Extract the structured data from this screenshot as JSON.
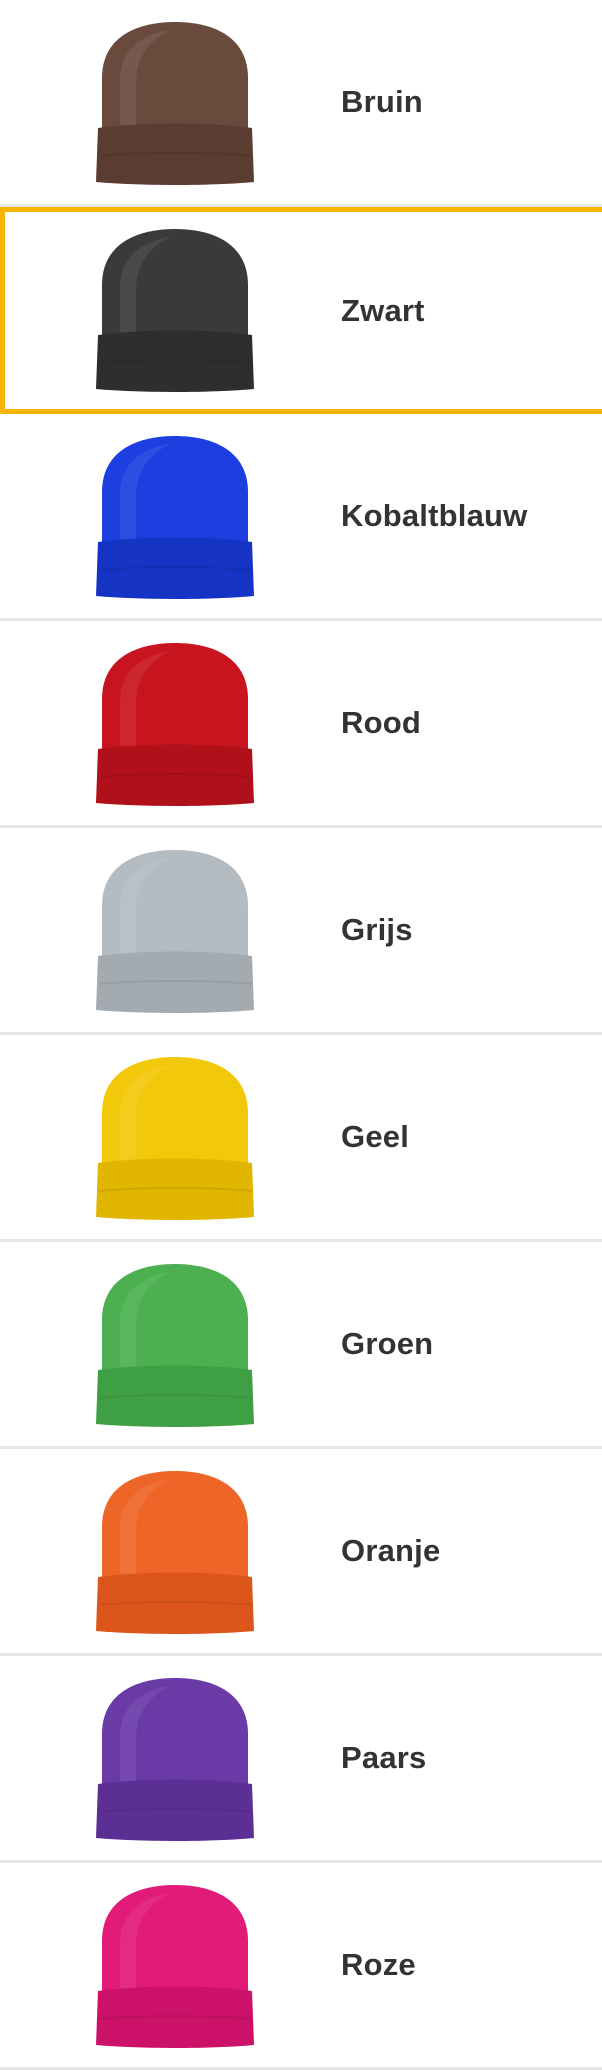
{
  "selected_index": 1,
  "colors": [
    {
      "label": "Bruin",
      "hex": "#6b4a3e",
      "shade": "#5a3c31",
      "icon": "beanie-brown-icon"
    },
    {
      "label": "Zwart",
      "hex": "#3a3a3d",
      "shade": "#2e2e31",
      "icon": "beanie-black-icon"
    },
    {
      "label": "Kobaltblauw",
      "hex": "#1d3fe0",
      "shade": "#1634c4",
      "icon": "beanie-cobalt-blue-icon"
    },
    {
      "label": "Rood",
      "hex": "#c8141f",
      "shade": "#b01019",
      "icon": "beanie-red-icon"
    },
    {
      "label": "Grijs",
      "hex": "#b4bcc2",
      "shade": "#a3abb1",
      "icon": "beanie-grey-icon"
    },
    {
      "label": "Geel",
      "hex": "#f2c80a",
      "shade": "#e0b600",
      "icon": "beanie-yellow-icon"
    },
    {
      "label": "Groen",
      "hex": "#4cb050",
      "shade": "#3f9f44",
      "icon": "beanie-green-icon"
    },
    {
      "label": "Oranje",
      "hex": "#ee6528",
      "shade": "#dc561c",
      "icon": "beanie-orange-icon"
    },
    {
      "label": "Paars",
      "hex": "#6a3aa6",
      "shade": "#5b2f94",
      "icon": "beanie-purple-icon"
    },
    {
      "label": "Roze",
      "hex": "#e21a78",
      "shade": "#cc1268",
      "icon": "beanie-pink-icon"
    }
  ]
}
